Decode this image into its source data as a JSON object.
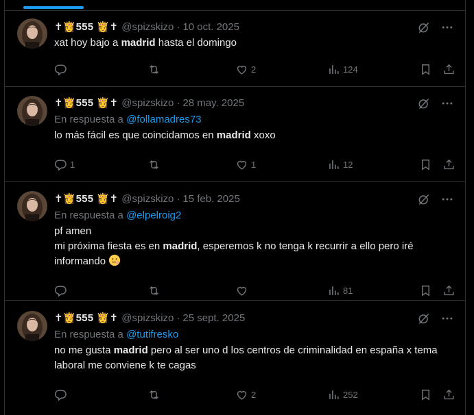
{
  "tweets": [
    {
      "name": "✝👸555 👸✝",
      "handle": "@spizskizo",
      "sep": "·",
      "date": "10 oct. 2025",
      "reply_prefix": "",
      "reply_to": "",
      "text_parts": [
        "xat hoy bajo a ",
        "madrid",
        " hasta el domingo"
      ],
      "replies": "",
      "retweets": "",
      "likes": "2",
      "views": "124"
    },
    {
      "name": "✝👸555 👸✝",
      "handle": "@spizskizo",
      "sep": "·",
      "date": "28 may. 2025",
      "reply_prefix": "En respuesta a",
      "reply_to": "@follamadres73",
      "text_parts": [
        "lo más fácil es que coincidamos en ",
        "madrid",
        " xoxo"
      ],
      "replies": "1",
      "retweets": "",
      "likes": "1",
      "views": "12"
    },
    {
      "name": "✝👸555 👸✝",
      "handle": "@spizskizo",
      "sep": "·",
      "date": "15 feb. 2025",
      "reply_prefix": "En respuesta a",
      "reply_to": "@elpelroig2",
      "text_line1": "pf amen",
      "text_parts": [
        "mi próxima fiesta es en ",
        "madrid",
        ", esperemos k no tenga k recurrir a ello pero iré informando"
      ],
      "replies": "",
      "retweets": "",
      "likes": "",
      "views": "81"
    },
    {
      "name": "✝👸555 👸✝",
      "handle": "@spizskizo",
      "sep": "·",
      "date": "25 sept. 2025",
      "reply_prefix": "En respuesta a",
      "reply_to": "@tutifresko",
      "text_parts": [
        "no me gusta ",
        "madrid",
        " pero al ser uno d los centros de criminalidad en españa x tema laboral me conviene k te cagas"
      ],
      "replies": "",
      "retweets": "",
      "likes": "2",
      "views": "252"
    }
  ],
  "icons": {
    "grok": "grok-icon",
    "more": "more-icon",
    "reply": "reply-icon",
    "retweet": "retweet-icon",
    "like": "heart-icon",
    "views": "views-icon",
    "bookmark": "bookmark-icon",
    "share": "share-icon"
  },
  "colors": {
    "background": "#000000",
    "text": "#e7e9ea",
    "muted": "#71767b",
    "accent": "#1d9bf0",
    "border": "#2f3336"
  }
}
